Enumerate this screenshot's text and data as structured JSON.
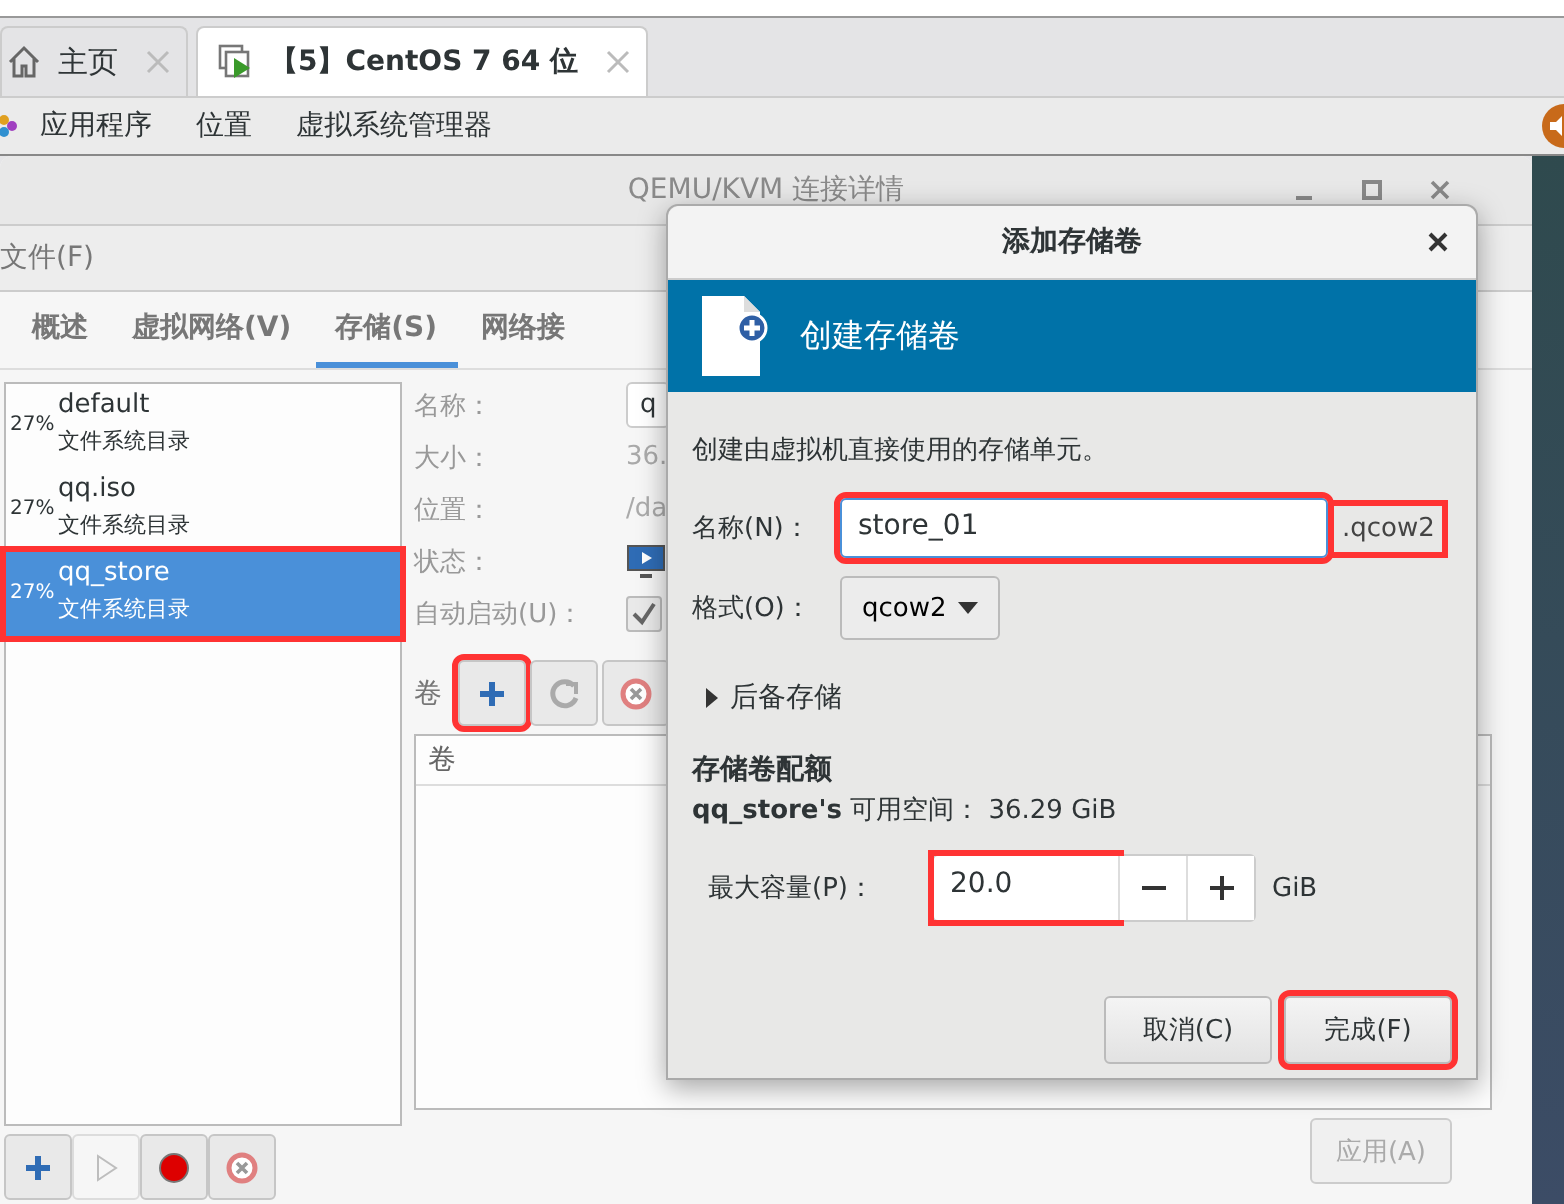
{
  "browser_tabs": [
    {
      "label": "主页",
      "selected": false
    },
    {
      "label": "【5】CentOS 7 64 位",
      "selected": true
    }
  ],
  "top_bar": {
    "menus": [
      "应用程序",
      "位置",
      "虚拟系统管理器"
    ]
  },
  "window": {
    "title": "QEMU/KVM 连接详情",
    "menu": [
      "文件(F)"
    ],
    "tabs": [
      {
        "label": "概述",
        "selected": false
      },
      {
        "label": "虚拟网络(V)",
        "selected": false
      },
      {
        "label": "存储(S)",
        "selected": true
      },
      {
        "label": "网络接",
        "selected": false
      }
    ],
    "pools": [
      {
        "usage": "27%",
        "name": "default",
        "type": "文件系统目录",
        "selected": false,
        "highlighted": false
      },
      {
        "usage": "27%",
        "name": "qq.iso",
        "type": "文件系统目录",
        "selected": false,
        "highlighted": false
      },
      {
        "usage": "27%",
        "name": "qq_store",
        "type": "文件系统目录",
        "selected": true,
        "highlighted": true
      }
    ],
    "details": [
      {
        "kind": "field",
        "label": "名称：",
        "value": "q"
      },
      {
        "kind": "text",
        "label": "大小：",
        "value": "36."
      },
      {
        "kind": "text",
        "label": "位置：",
        "value": "/da"
      },
      {
        "kind": "status",
        "label": "状态："
      },
      {
        "kind": "checkbox",
        "label": "自动启动(U)：",
        "checked": true
      }
    ],
    "volume_label": "卷",
    "volume_tools": [
      {
        "kind": "add",
        "highlighted": true
      },
      {
        "kind": "refresh",
        "highlighted": false
      },
      {
        "kind": "delete",
        "highlighted": false
      }
    ],
    "volume_column": "卷",
    "pool_tools": [
      {
        "kind": "add",
        "disabled": false
      },
      {
        "kind": "start",
        "disabled": true
      },
      {
        "kind": "stop",
        "disabled": false
      },
      {
        "kind": "delete",
        "disabled": false
      }
    ],
    "apply_button": "应用(A)"
  },
  "dialog": {
    "title": "添加存储卷",
    "banner": "创建存储卷",
    "description": "创建由虚拟机直接使用的存储单元。",
    "name": {
      "label": "名称(N)：",
      "value": "store_01",
      "highlighted": true
    },
    "suffix": {
      "text": ".qcow2",
      "highlighted": true
    },
    "format": {
      "label": "格式(O)：",
      "value": "qcow2"
    },
    "backing": {
      "label": "后备存储",
      "expanded": false
    },
    "quota_title": "存储卷配额",
    "available": "**qq_store's** 可用空间： 36.29 GiB",
    "capacity": {
      "label": "最大容量(P)：",
      "value": "20.0",
      "unit": "GiB",
      "highlighted": true
    },
    "buttons": [
      {
        "label": "取消(C)",
        "highlighted": false
      },
      {
        "label": "完成(F)",
        "highlighted": true
      }
    ]
  }
}
